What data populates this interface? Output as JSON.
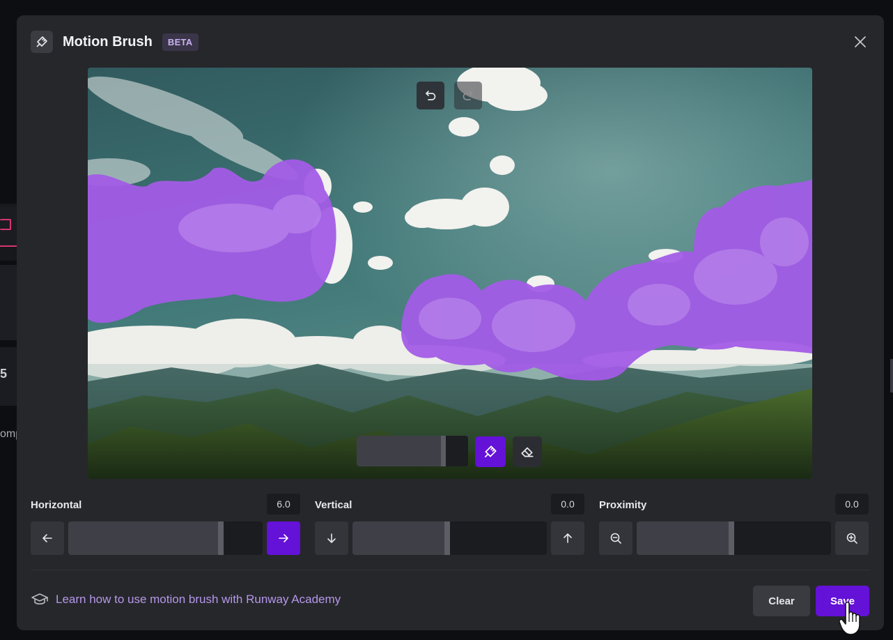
{
  "header": {
    "title": "Motion Brush",
    "badge": "BETA",
    "icon": "brush-icon",
    "close_icon": "close-icon"
  },
  "canvas": {
    "undo_icon": "undo-icon",
    "redo_icon": "redo-icon",
    "brush_size_level": 0.8,
    "brush_icon": "brush-icon",
    "eraser_icon": "eraser-icon",
    "brush_color": "#a25ce6"
  },
  "controls": {
    "horizontal": {
      "label": "Horizontal",
      "value": "6.0",
      "fill": 0.8,
      "left_icon": "arrow-left-icon",
      "right_icon": "arrow-right-icon",
      "active": "right"
    },
    "vertical": {
      "label": "Vertical",
      "value": "0.0",
      "fill": 0.5,
      "left_icon": "arrow-down-icon",
      "right_icon": "arrow-up-icon"
    },
    "proximity": {
      "label": "Proximity",
      "value": "0.0",
      "fill": 0.5,
      "left_icon": "zoom-out-icon",
      "right_icon": "zoom-in-icon"
    }
  },
  "footer": {
    "link_text": "Learn how to use motion brush with Runway Academy",
    "link_icon": "graduation-cap-icon",
    "clear_label": "Clear",
    "save_label": "Save"
  },
  "background": {
    "number": "5",
    "text": "omp"
  },
  "colors": {
    "accent": "#6411d8",
    "link": "#b597ea",
    "modal_bg": "#26272b"
  }
}
